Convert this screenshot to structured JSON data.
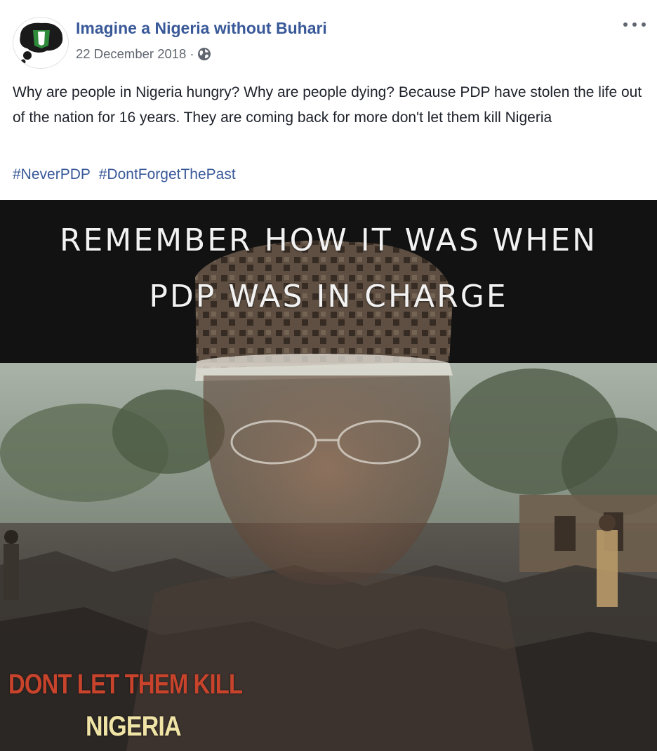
{
  "post": {
    "page_name": "Imagine a Nigeria without Buhari",
    "date": "22 December 2018",
    "separator": "·",
    "privacy_icon": "globe-icon",
    "more_icon": "more-options-icon",
    "message": "Why are people in Nigeria hungry? Why are people dying? Because PDP have stolen the life out of the nation for 16 years. They are coming back for more don't let them kill Nigeria",
    "hashtags": [
      "#NeverPDP",
      "#DontForgetThePast"
    ]
  },
  "image": {
    "headline_line1": "REMEMBER HOW IT WAS WHEN",
    "headline_line2": "PDP WAS IN CHARGE",
    "slogan_line1": "DONT LET THEM KILL",
    "slogan_line2": "NIGERIA"
  },
  "colors": {
    "link": "#385898",
    "text": "#1d2129",
    "meta": "#606770",
    "slogan_red": "#c8432b",
    "slogan_cream": "#f0e3a6"
  }
}
